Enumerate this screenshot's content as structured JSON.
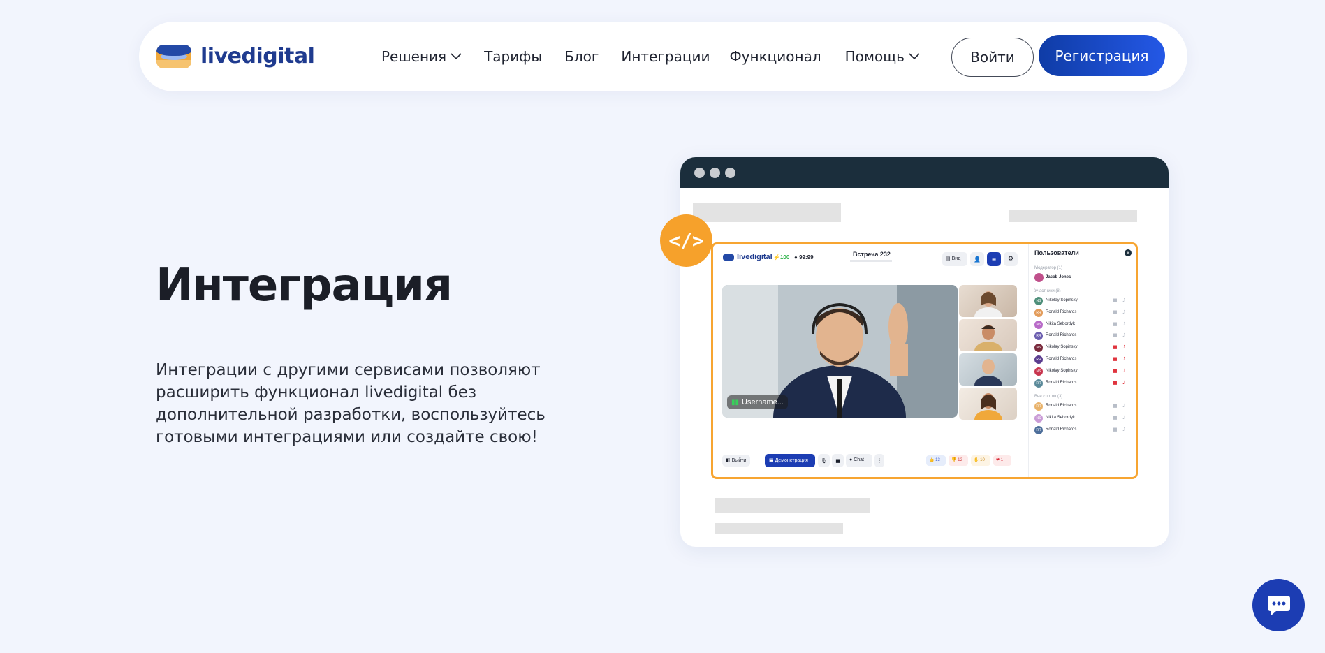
{
  "brand": {
    "name": "livedigital"
  },
  "nav": {
    "items": [
      {
        "label": "Решения",
        "dropdown": true
      },
      {
        "label": "Тарифы",
        "dropdown": false
      },
      {
        "label": "Блог",
        "dropdown": false
      },
      {
        "label": "Интеграции",
        "dropdown": false
      },
      {
        "label": "Функционал",
        "dropdown": false
      },
      {
        "label": "Помощь",
        "dropdown": true
      }
    ],
    "login_label": "Войти",
    "register_label": "Регистрация"
  },
  "hero": {
    "title": "Интеграция",
    "description": "Интеграции с другими сервисами позволяют расширить функционал livedigital без дополнительной разработки, воспользуйтесь готовыми интеграциями или создайте свою!"
  },
  "mockup": {
    "badge_text": "</>",
    "app": {
      "brand": "livedigital",
      "score": "100",
      "timer": "99:99",
      "meeting_title": "Встреча 232",
      "view_label": "Вид",
      "main_user": "Username...",
      "exit_label": "Выйти",
      "demo_label": "Демонстрация",
      "chat_label": "Chat",
      "reactions": [
        "13",
        "12",
        "10",
        "1"
      ],
      "users_panel": {
        "title": "Пользователи",
        "moderator_label": "Модератор (1)",
        "moderator": {
          "initials": "JJ",
          "name": "Jacob Jones",
          "color": "#c0508b"
        },
        "participants_label": "Участники (8)",
        "participants": [
          {
            "initials": "NS",
            "name": "Nikolay Sopinsky",
            "color": "#4e8f7a",
            "muted": false
          },
          {
            "initials": "RR",
            "name": "Ronald Richards",
            "color": "#e39c5b",
            "muted": false
          },
          {
            "initials": "NS",
            "name": "Nikita Sebordyk",
            "color": "#b86ac8",
            "muted": false
          },
          {
            "initials": "RR",
            "name": "Ronald Richards",
            "color": "#6c5fb0",
            "muted": false
          },
          {
            "initials": "NS",
            "name": "Nikolay Sopinsky",
            "color": "#7a2a3c",
            "muted": true
          },
          {
            "initials": "RR",
            "name": "Ronald Richards",
            "color": "#5b3d8f",
            "muted": true
          },
          {
            "initials": "NS",
            "name": "Nikolay Sopinsky",
            "color": "#c8354e",
            "muted": true
          },
          {
            "initials": "RR",
            "name": "Ronald Richards",
            "color": "#5b8a9a",
            "muted": true
          }
        ],
        "outside_label": "Вне слотов (3)",
        "outside": [
          {
            "initials": "RR",
            "name": "Ronald Richards",
            "color": "#e8b26a"
          },
          {
            "initials": "NS",
            "name": "Nikita Sebordyk",
            "color": "#c99bd6"
          },
          {
            "initials": "RR",
            "name": "Ronald Richards",
            "color": "#4d6e9a"
          }
        ]
      }
    }
  },
  "colors": {
    "accent": "#1c3db3",
    "orange": "#f6a12b",
    "background": "#f2f5fd"
  }
}
